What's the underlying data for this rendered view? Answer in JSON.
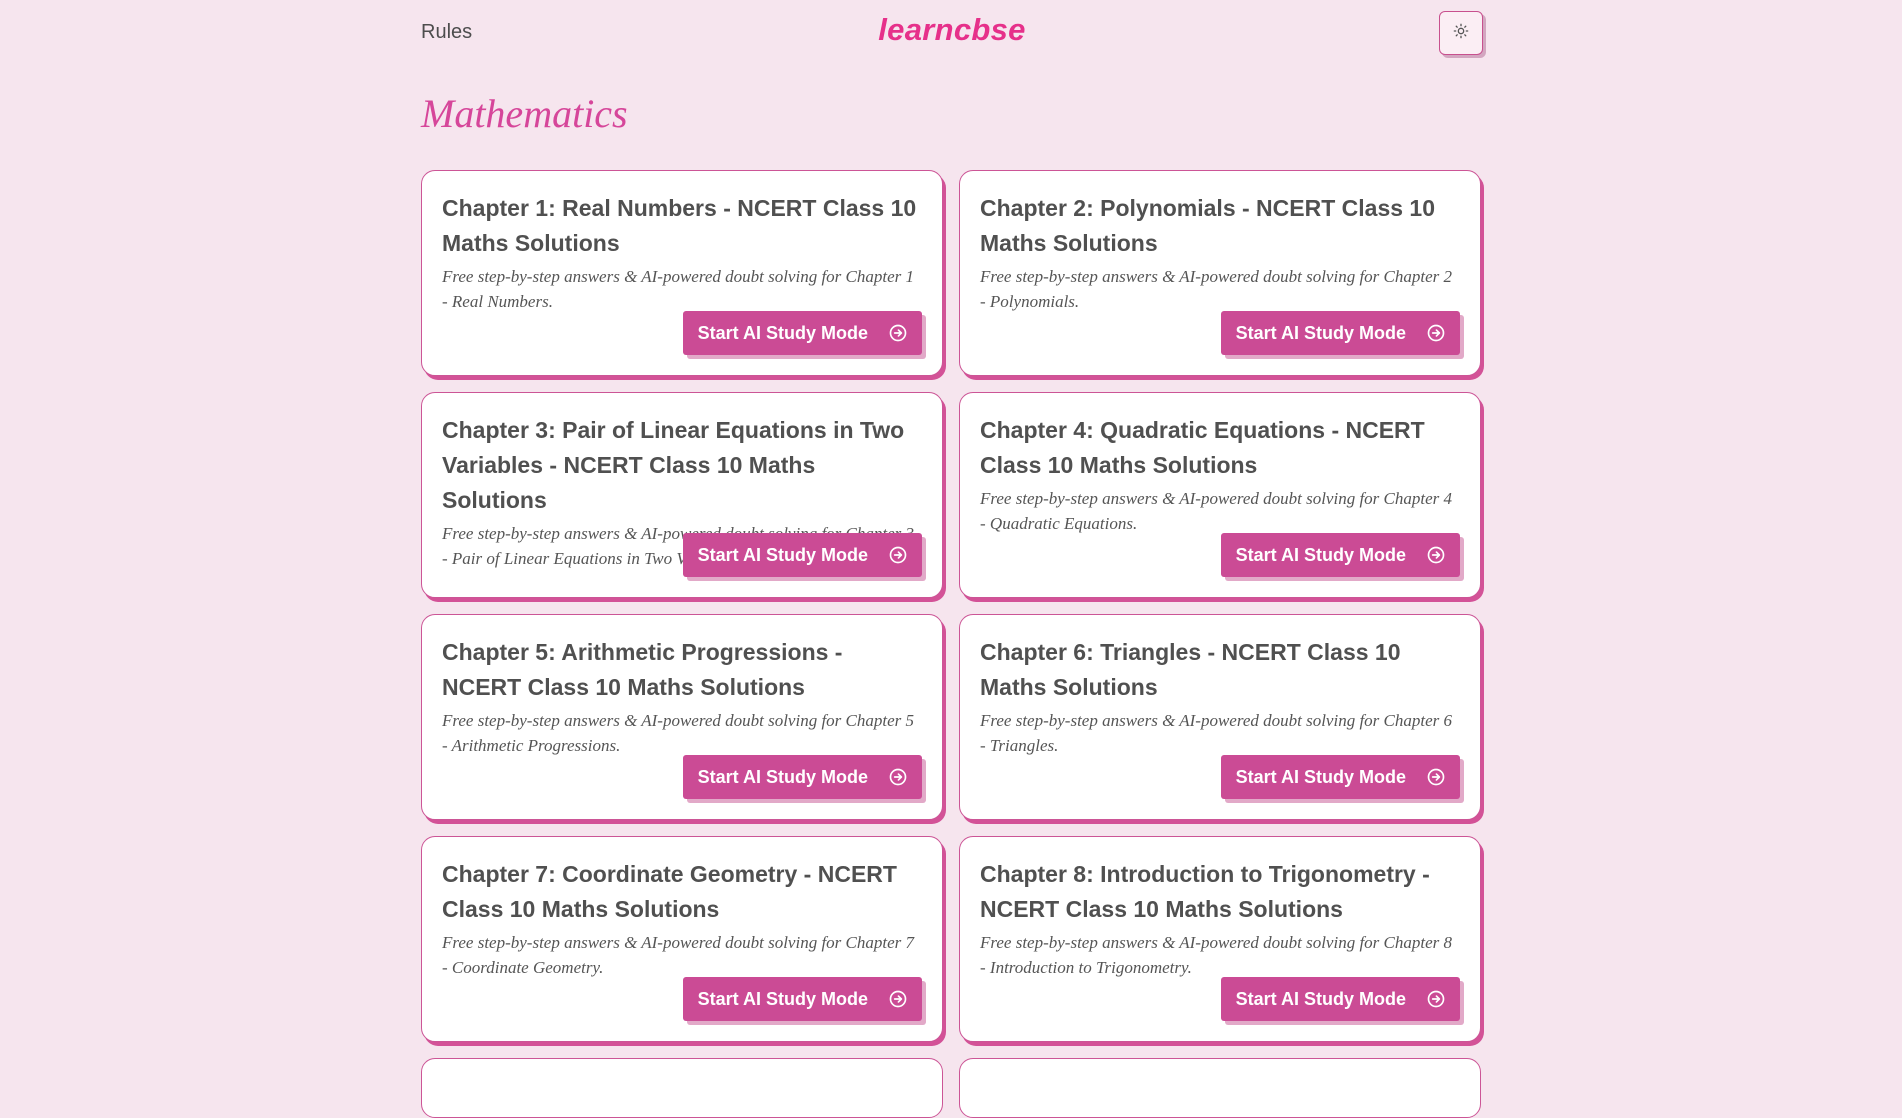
{
  "header": {
    "rules_label": "Rules",
    "logo": "learncbse",
    "theme_icon": "sun-icon"
  },
  "page": {
    "title": "Mathematics"
  },
  "colors": {
    "background": "#f6e5ee",
    "accent": "#cb4b95",
    "logo": "#e6308a"
  },
  "cards": [
    {
      "title": "Chapter 1: Real Numbers - NCERT Class 10 Maths Solutions",
      "description": "Free step-by-step answers & AI-powered doubt solving for Chapter 1 - Real Numbers.",
      "button": "Start AI Study Mode"
    },
    {
      "title": "Chapter 2: Polynomials - NCERT Class 10 Maths Solutions",
      "description": "Free step-by-step answers & AI-powered doubt solving for Chapter 2 - Polynomials.",
      "button": "Start AI Study Mode"
    },
    {
      "title": "Chapter 3: Pair of Linear Equations in Two Variables - NCERT Class 10 Maths Solutions",
      "description": "Free step-by-step answers & AI-powered doubt solving for Chapter 3 - Pair of Linear Equations in Two Variables.",
      "button": "Start AI Study Mode"
    },
    {
      "title": "Chapter 4: Quadratic Equations - NCERT Class 10 Maths Solutions",
      "description": "Free step-by-step answers & AI-powered doubt solving for Chapter 4 - Quadratic Equations.",
      "button": "Start AI Study Mode"
    },
    {
      "title": "Chapter 5: Arithmetic Progressions - NCERT Class 10 Maths Solutions",
      "description": "Free step-by-step answers & AI-powered doubt solving for Chapter 5 - Arithmetic Progressions.",
      "button": "Start AI Study Mode"
    },
    {
      "title": "Chapter 6: Triangles - NCERT Class 10 Maths Solutions",
      "description": "Free step-by-step answers & AI-powered doubt solving for Chapter 6 - Triangles.",
      "button": "Start AI Study Mode"
    },
    {
      "title": "Chapter 7: Coordinate Geometry - NCERT Class 10 Maths Solutions",
      "description": "Free step-by-step answers & AI-powered doubt solving for Chapter 7 - Coordinate Geometry.",
      "button": "Start AI Study Mode"
    },
    {
      "title": "Chapter 8: Introduction to Trigonometry - NCERT Class 10 Maths Solutions",
      "description": "Free step-by-step answers & AI-powered doubt solving for Chapter 8 - Introduction to Trigonometry.",
      "button": "Start AI Study Mode"
    }
  ]
}
